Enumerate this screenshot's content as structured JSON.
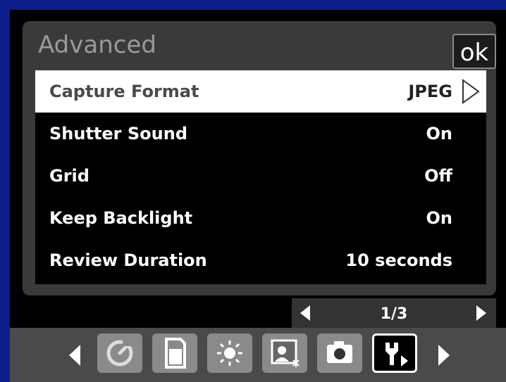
{
  "panel": {
    "title": "Advanced",
    "ok_label": "ok"
  },
  "settings": [
    {
      "label": "Capture Format",
      "value": "JPEG",
      "selected": true
    },
    {
      "label": "Shutter Sound",
      "value": "On"
    },
    {
      "label": "Grid",
      "value": "Off"
    },
    {
      "label": "Keep Backlight",
      "value": "On"
    },
    {
      "label": "Review Duration",
      "value": "10 seconds"
    }
  ],
  "pager": {
    "text": "1/3"
  },
  "toolbar": {
    "icons": [
      "timer-icon",
      "card-icon",
      "brightness-icon",
      "picture-effect-icon",
      "camera-icon",
      "settings-wrench-icon"
    ],
    "active": "settings-wrench-icon"
  },
  "colors": {
    "background": "#0a1e8a",
    "panel": "#3a3a3a",
    "selected_row": "#ffffff",
    "toolbar": "#4a4a4a"
  }
}
